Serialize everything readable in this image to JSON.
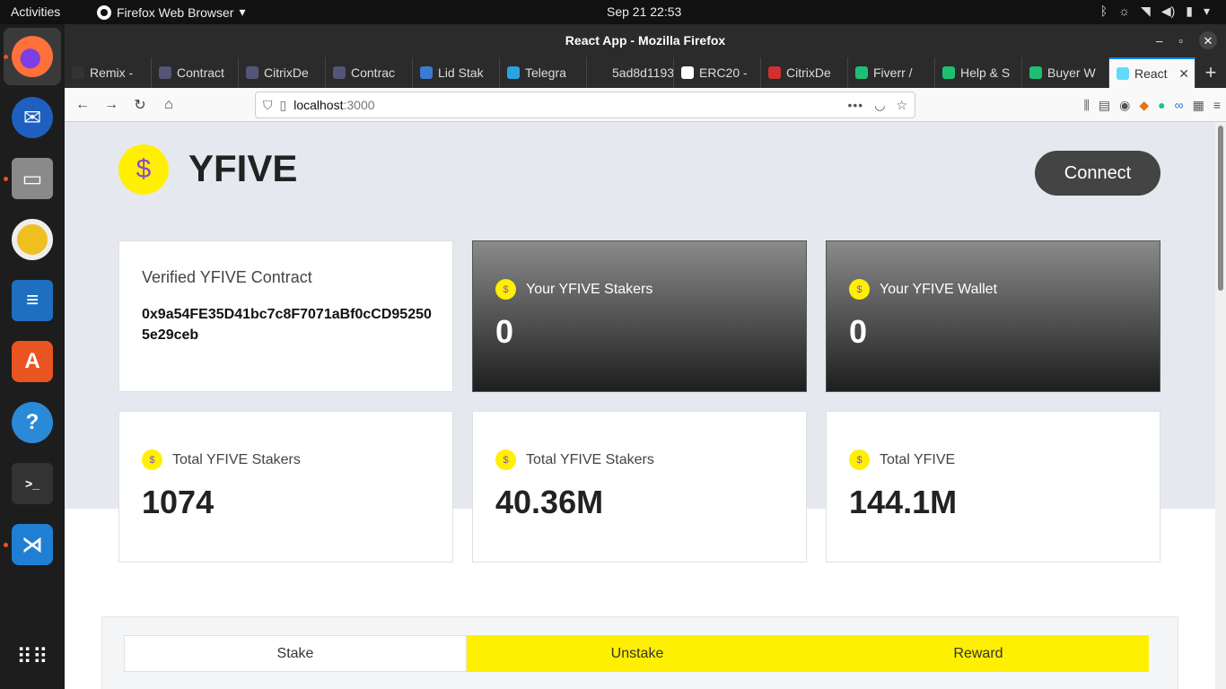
{
  "topbar": {
    "activities": "Activities",
    "app_menu": "Firefox Web Browser",
    "clock": "Sep 21  22:53"
  },
  "window": {
    "title": "React App - Mozilla Firefox"
  },
  "tabs": [
    {
      "label": "Remix -",
      "color": "#333333"
    },
    {
      "label": "Contract",
      "color": "#555577"
    },
    {
      "label": "CitrixDe",
      "color": "#555577"
    },
    {
      "label": "Contrac",
      "color": "#555577"
    },
    {
      "label": "Lid Stak",
      "color": "#3b7bd4"
    },
    {
      "label": "Telegra",
      "color": "#2aa3e0"
    },
    {
      "label": "5ad8d1193",
      "color": "#2b2b2b"
    },
    {
      "label": "ERC20 -",
      "color": "#ffffff"
    },
    {
      "label": "CitrixDe",
      "color": "#d0312d"
    },
    {
      "label": "Fiverr / ",
      "color": "#1dbf73"
    },
    {
      "label": "Help & S",
      "color": "#1dbf73"
    },
    {
      "label": "Buyer W",
      "color": "#1dbf73"
    },
    {
      "label": "React",
      "color": "#61dafb"
    }
  ],
  "url": {
    "host": "localhost",
    "port": ":3000"
  },
  "app": {
    "brand": "YFIVE",
    "logo_symbol": "$",
    "connect_label": "Connect",
    "contract_title": "Verified YFIVE Contract",
    "contract_address": "0x9a54FE35D41bc7c8F7071aBf0cCD952505e29ceb",
    "cards": [
      {
        "label": "Your YFIVE Stakers",
        "value": "0"
      },
      {
        "label": "Your YFIVE Wallet",
        "value": "0"
      },
      {
        "label": "Total YFIVE Stakers",
        "value": "1074"
      },
      {
        "label": "Total YFIVE Stakers",
        "value": "40.36M"
      },
      {
        "label": "Total YFIVE",
        "value": "144.1M"
      }
    ],
    "action_tabs": [
      "Stake",
      "Unstake",
      "Reward"
    ]
  },
  "colors": {
    "accent": "#ffef00",
    "dark": "#444444",
    "page_bg": "#e6e8ef"
  }
}
